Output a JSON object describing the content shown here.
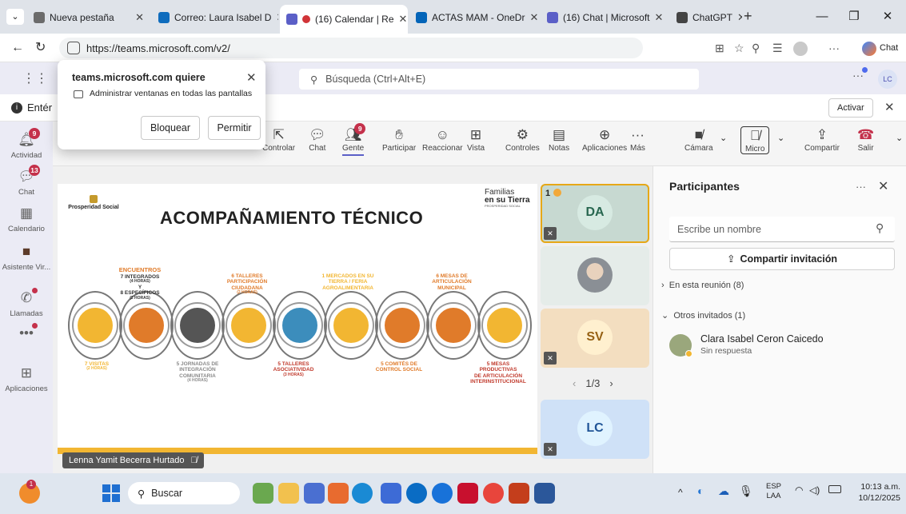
{
  "browser": {
    "tabs": [
      {
        "label": "Nueva pestaña",
        "icon": "new-tab-icon",
        "color": "#6b6b6b"
      },
      {
        "label": "Correo: Laura Isabel D",
        "icon": "outlook-icon",
        "color": "#0f6cbd"
      },
      {
        "label": "(16) Calendar | Re",
        "icon": "teams-icon",
        "color": "#5b5fc7",
        "active": true
      },
      {
        "label": "ACTAS MAM - OneDr",
        "icon": "onedrive-icon",
        "color": "#0364b8"
      },
      {
        "label": "(16) Chat | Microsoft",
        "icon": "teams-icon",
        "color": "#5b5fc7"
      },
      {
        "label": "ChatGPT",
        "icon": "chatgpt-icon",
        "color": "#444444"
      }
    ],
    "url": "https://teams.microsoft.com/v2/",
    "copilot_label": "Chat"
  },
  "permission_popup": {
    "title": "teams.microsoft.com quiere",
    "message": "Administrar ventanas en todas las pantallas",
    "block_label": "Bloquear",
    "allow_label": "Permitir"
  },
  "teams": {
    "search_placeholder": "Búsqueda (Ctrl+Alt+E)",
    "user_initials": "LC",
    "banner_text": "Entér",
    "banner_button": "Activar"
  },
  "rail": [
    {
      "label": "Actividad",
      "icon": "bell-icon",
      "badge": "9"
    },
    {
      "label": "Chat",
      "icon": "chat-icon",
      "badge": "13"
    },
    {
      "label": "Calendario",
      "icon": "calendar-icon"
    },
    {
      "label": "Asistente Vir...",
      "icon": "assistant-icon"
    },
    {
      "label": "Llamadas",
      "icon": "phone-icon",
      "dot": true
    },
    {
      "label": "...",
      "icon": "more-icon",
      "dot": true
    },
    {
      "label": "Aplicaciones",
      "icon": "apps-icon"
    }
  ],
  "meeting_toolbar": [
    {
      "label": "Controlar",
      "icon": "control-icon"
    },
    {
      "label": "Chat",
      "icon": "chat-icon"
    },
    {
      "label": "Gente",
      "icon": "people-icon",
      "badge": "9",
      "active": true
    },
    {
      "label": "Participar",
      "icon": "raise-hand-icon"
    },
    {
      "label": "Reaccionar",
      "icon": "emoji-icon"
    },
    {
      "label": "Vista",
      "icon": "view-icon"
    },
    {
      "label": "Controles",
      "icon": "controls-icon"
    },
    {
      "label": "Notas",
      "icon": "notes-icon"
    },
    {
      "label": "Aplicaciones",
      "icon": "apps-add-icon"
    },
    {
      "label": "Más",
      "icon": "more-icon"
    },
    {
      "label": "Cámara",
      "icon": "camera-off-icon"
    },
    {
      "label": "Micro",
      "icon": "mic-off-icon"
    },
    {
      "label": "Compartir",
      "icon": "share-icon"
    },
    {
      "label": "Salir",
      "icon": "hangup-icon"
    }
  ],
  "slide": {
    "org": "Prosperidad Social",
    "brand_line1": "Familias",
    "brand_line2": "en su Tierra",
    "brand_line3": "PROSPERIDAD SOCIAL",
    "title": "ACOMPAÑAMIENTO TÉCNICO",
    "top_labels": [
      {
        "text": "ENCUENTROS",
        "color": "#e07b2a"
      },
      {
        "text": "7 INTEGRADOS",
        "color": "#333333"
      },
      {
        "text": "(4 HORAS)",
        "color": "#333333"
      },
      {
        "text": "Y",
        "color": "#333333"
      },
      {
        "text": "8 ESPECÍFICOS",
        "color": "#333333"
      },
      {
        "text": "(2 HORAS)",
        "color": "#333333"
      }
    ],
    "upper_items": [
      {
        "lines": [
          "6 TALLERES",
          "PARTICIPACIÓN",
          "CIUDADANA"
        ],
        "sub": "(2 HORAS)",
        "color": "#e07b2a"
      },
      {
        "lines": [
          "1 MERCADOS EN SU",
          "TIERRA / FERIA",
          "AGROALIMENTARIA"
        ],
        "sub": "",
        "color": "#f2b632"
      },
      {
        "lines": [
          "6 MESAS DE",
          "ARTICULACIÓN",
          "MUNICIPAL"
        ],
        "sub": "",
        "color": "#e07b2a"
      }
    ],
    "lower_items": [
      {
        "lines": [
          "7 VISITAS"
        ],
        "sub": "(2 HORAS)",
        "color": "#f2b632"
      },
      {
        "lines": [
          "5 JORNADAS DE",
          "INTEGRACIÓN",
          "COMUNITARIA"
        ],
        "sub": "(4 HORAS)",
        "color": "#8a8a8a"
      },
      {
        "lines": [
          "5 TALLERES",
          "ASOCIATIVIDAD"
        ],
        "sub": "(3 HORAS)",
        "color": "#c0392b"
      },
      {
        "lines": [
          "5 COMITÉS DE",
          "CONTROL SOCIAL"
        ],
        "sub": "",
        "color": "#e07b2a"
      },
      {
        "lines": [
          "5 MESAS",
          "PRODUCTIVAS",
          "DE ARTICULACIÓN",
          "INTERINSTITUCIONAL"
        ],
        "sub": "",
        "color": "#c0392b"
      }
    ],
    "circles": [
      {
        "icon": "house-icon",
        "color": "#f2b632"
      },
      {
        "icon": "group-icon",
        "color": "#e07b2a"
      },
      {
        "icon": "network-icon",
        "color": "#555555"
      },
      {
        "icon": "handshake-icon",
        "color": "#f2b632"
      },
      {
        "icon": "team-icon",
        "color": "#3c8dbc"
      },
      {
        "icon": "food-basket-icon",
        "color": "#f2b632"
      },
      {
        "icon": "meeting-icon",
        "color": "#e07b2a"
      },
      {
        "icon": "table-meeting-icon",
        "color": "#e07b2a"
      },
      {
        "icon": "brain-icon",
        "color": "#f2b632"
      }
    ],
    "presenter": "Lenna Yamit Becerra Hurtado"
  },
  "video_tiles": [
    {
      "initials": "DA",
      "count": "1",
      "highlighted": true,
      "bg": "#c7d9d1",
      "fg": "#255f4a"
    },
    {
      "initials": "",
      "photo": true,
      "bg": "#e5ece9"
    },
    {
      "initials": "SV",
      "bg": "#f3dec0",
      "fg": "#8a5a12"
    },
    {
      "initials": "LC",
      "bg": "#cfe1f7",
      "fg": "#1f4f8a"
    }
  ],
  "pagination": "1/3",
  "participants": {
    "title": "Participantes",
    "search_placeholder": "Escribe un nombre",
    "share_label": "Compartir invitación",
    "in_meeting": "En esta reunión (8)",
    "others": "Otros invitados (1)",
    "invitee_name": "Clara Isabel Ceron Caicedo",
    "invitee_status": "Sin respuesta"
  },
  "taskbar": {
    "search_label": "Buscar",
    "lang_line1": "ESP",
    "lang_line2": "LAA",
    "time": "10:13 a.m.",
    "date": "10/12/2025",
    "apps": [
      {
        "icon": "landscape-icon",
        "color": "#6aa84f"
      },
      {
        "icon": "file-explorer-icon",
        "color": "#f2c14e"
      },
      {
        "icon": "widgets-icon",
        "color": "#4a6fd1"
      },
      {
        "icon": "colorful-app-icon",
        "color": "#e86b2f"
      },
      {
        "icon": "edge-icon",
        "color": "#1a8ad4"
      },
      {
        "icon": "store-icon",
        "color": "#3d6bd6"
      },
      {
        "icon": "hp-icon",
        "color": "#0a6cc4"
      },
      {
        "icon": "support-icon",
        "color": "#1872d9"
      },
      {
        "icon": "mcafee-icon",
        "color": "#c8102e"
      },
      {
        "icon": "chrome-icon",
        "color": "#e8453c"
      },
      {
        "icon": "powerpoint-icon",
        "color": "#c43e1c"
      },
      {
        "icon": "word-icon",
        "color": "#2b579a"
      }
    ]
  }
}
